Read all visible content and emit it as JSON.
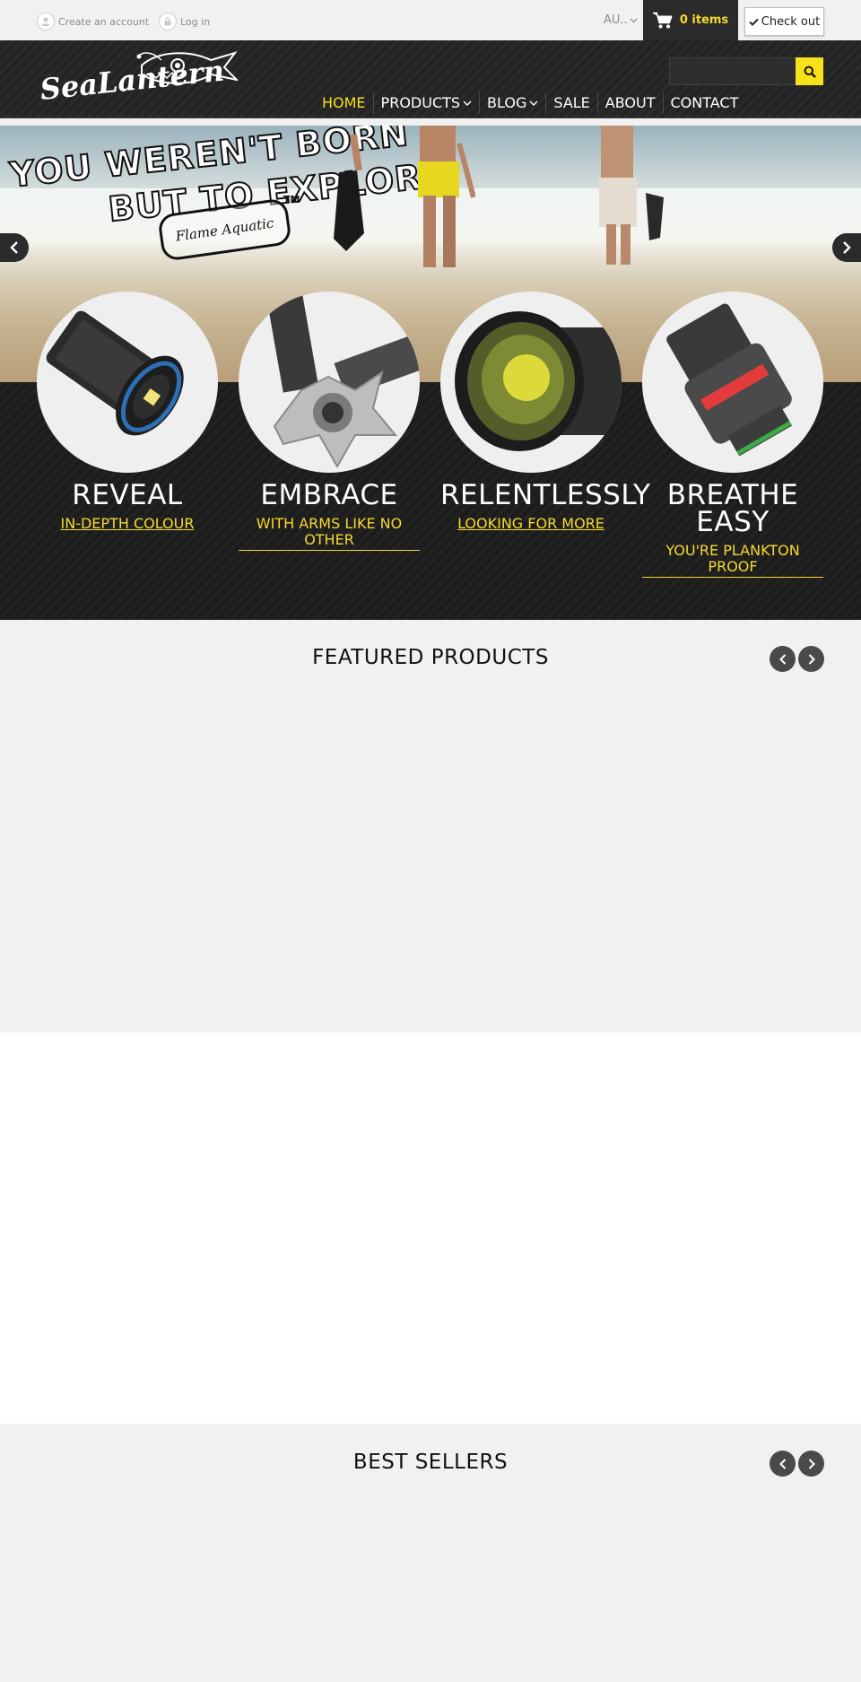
{
  "topbar": {
    "create_account": "Create an account",
    "login": "Log in",
    "currency": "AU..",
    "cart_count": "0 items",
    "checkout": "Check out"
  },
  "header": {
    "brand": "SeaLantern",
    "nav": [
      {
        "label": "HOME",
        "active": true,
        "dropdown": false
      },
      {
        "label": "PRODUCTS",
        "active": false,
        "dropdown": true
      },
      {
        "label": "BLOG",
        "active": false,
        "dropdown": true
      },
      {
        "label": "SALE",
        "active": false,
        "dropdown": false
      },
      {
        "label": "ABOUT",
        "active": false,
        "dropdown": false
      },
      {
        "label": "CONTACT",
        "active": false,
        "dropdown": false
      }
    ],
    "search_placeholder": ""
  },
  "hero": {
    "slogan_line1": "YOU WEREN'T BORN",
    "slogan_line2": "BUT TO EXPLORE",
    "signature": "Flame Aquatic",
    "trademark": "TM"
  },
  "features": [
    {
      "title": "REVEAL",
      "subtitle": "IN-DEPTH COLOUR"
    },
    {
      "title": "EMBRACE",
      "subtitle": "WITH ARMS LIKE NO OTHER"
    },
    {
      "title": "RELENTLESSLY",
      "subtitle": "LOOKING FOR MORE"
    },
    {
      "title": "BREATHE EASY",
      "subtitle": "YOU'RE PLANKTON PROOF"
    }
  ],
  "sections": {
    "featured": "FEATURED PRODUCTS",
    "best_sellers": "BEST SELLERS"
  },
  "colors": {
    "accent_yellow": "#f6e11a",
    "dark": "#2b2b2b",
    "light_bg": "#f1f1f1"
  }
}
